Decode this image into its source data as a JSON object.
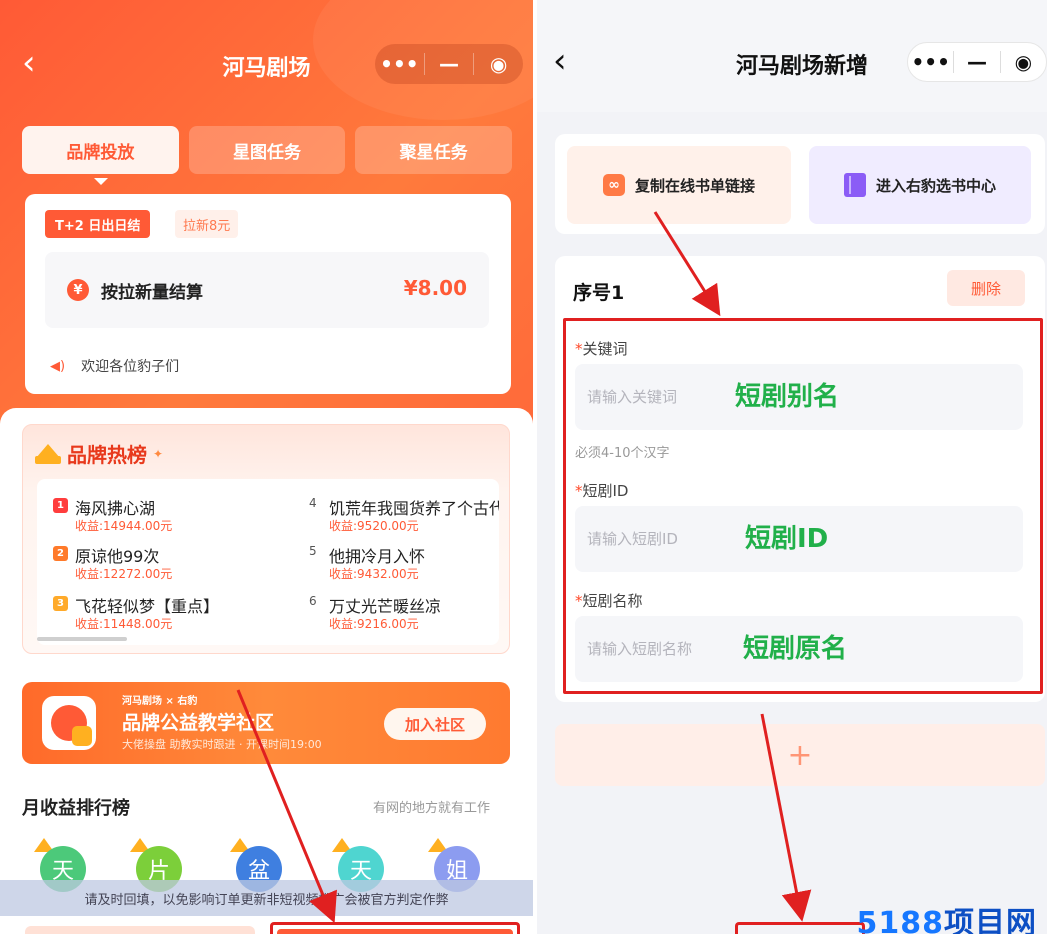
{
  "left": {
    "nav": {
      "title": "河马剧场"
    },
    "tabs": [
      "品牌投放",
      "星图任务",
      "聚星任务"
    ],
    "settle_card": {
      "badge": "T+2 日出日结",
      "tag": "拉新8元",
      "label": "按拉新量结算",
      "amount": "¥8.00",
      "welcome": "欢迎各位豹子们"
    },
    "hot": {
      "title": "品牌热榜",
      "items": [
        {
          "rank": "1",
          "name": "海风拂心湖",
          "income": "收益:14944.00元"
        },
        {
          "rank": "2",
          "name": "原谅他99次",
          "income": "收益:12272.00元"
        },
        {
          "rank": "3",
          "name": "飞花轻似梦【重点】",
          "income": "收益:11448.00元"
        },
        {
          "rank": "4",
          "name": "饥荒年我囤货养了个古代",
          "income": "收益:9520.00元"
        },
        {
          "rank": "5",
          "name": "他拥冷月入怀",
          "income": "收益:9432.00元"
        },
        {
          "rank": "6",
          "name": "万丈光芒暖丝凉",
          "income": "收益:9216.00元"
        }
      ]
    },
    "banner": {
      "small": "河马剧场 × 右豹",
      "title": "品牌公益教学社区",
      "subtitle": "大佬操盘 助教实时跟进 · 开课时间19:00",
      "button": "加入社区"
    },
    "monthly": {
      "title": "月收益排行榜",
      "right": "有网的地方就有工作",
      "avatars": [
        "天",
        "片",
        "盆",
        "天",
        "姐"
      ]
    },
    "notice": "请及时回填，以免影响订单更新非短视频推广会被官方判定作弊"
  },
  "right": {
    "nav": {
      "title": "河马剧场新增"
    },
    "actions": {
      "copy": "复制在线书单链接",
      "enter": "进入右豹选书中心"
    },
    "form": {
      "title": "序号1",
      "delete": "删除",
      "keyword": {
        "label": "关键词",
        "placeholder": "请输入关键词",
        "note": "短剧别名"
      },
      "hint": "必须4-10个汉字",
      "drama_id": {
        "label": "短剧ID",
        "placeholder": "请输入短剧ID",
        "note": "短剧ID"
      },
      "drama_name": {
        "label": "短剧名称",
        "placeholder": "请输入短剧名称",
        "note": "短剧原名"
      },
      "required_mark": "*"
    },
    "add": "+"
  },
  "watermark": {
    "number": "5188",
    "text": "项目网"
  },
  "colors": {
    "brand_orange": "#ff5a36",
    "annotation_red": "#e02020",
    "note_green": "#21b04a",
    "watermark_blue": "#1677ff"
  }
}
